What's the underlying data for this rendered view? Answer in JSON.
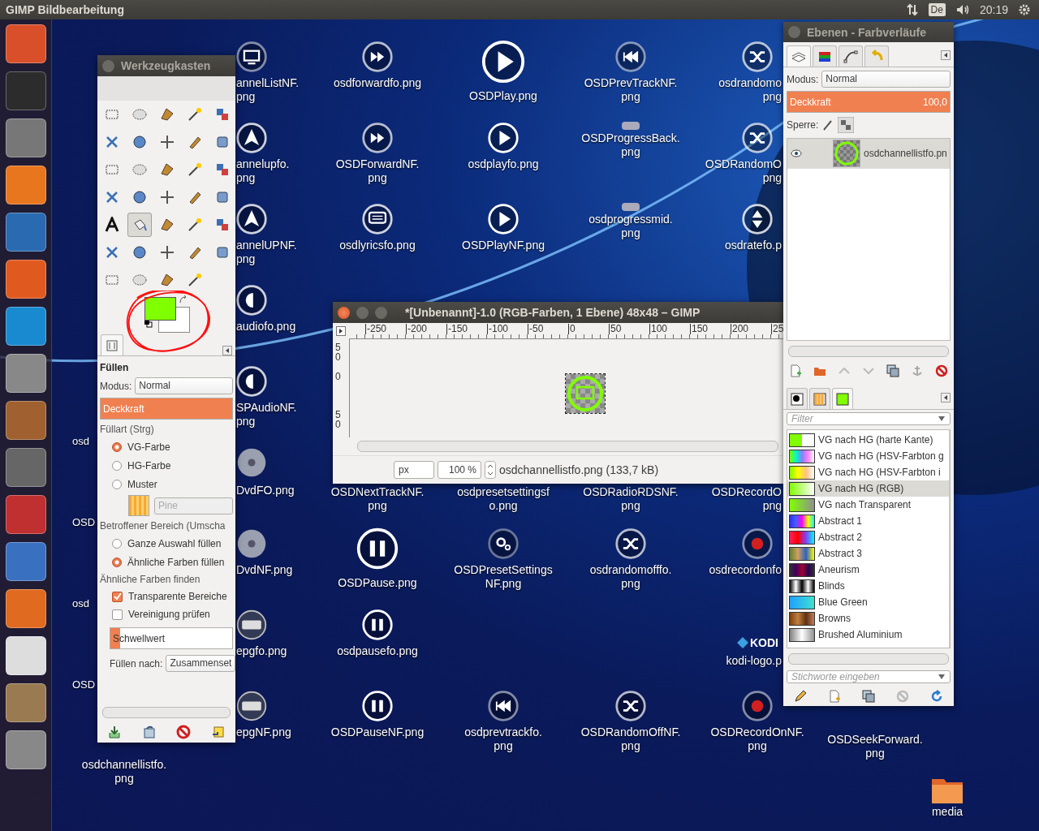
{
  "top_panel": {
    "title": "GIMP Bildbearbeitung",
    "keyboard_layout": "De",
    "time": "20:19"
  },
  "desktop_icons": [
    {
      "label": "annelListNF.\npng",
      "kind": "monitor"
    },
    {
      "label": "osdforwardfo.png",
      "kind": "forward"
    },
    {
      "label": "OSDPlay.png",
      "kind": "play"
    },
    {
      "label": "OSDPrevTrackNF.\npng",
      "kind": "rewind"
    },
    {
      "label": "osdrandomo\npng",
      "kind": "shuffle"
    },
    {
      "label": "annelupfo.\npng",
      "kind": "up"
    },
    {
      "label": "OSDForwardNF.\npng",
      "kind": "forward"
    },
    {
      "label": "osdplayfo.png",
      "kind": "play"
    },
    {
      "label": "OSDProgressBack.\npng",
      "kind": "bar"
    },
    {
      "label": "OSDRandomO\npng",
      "kind": "shuffle"
    },
    {
      "label": "annelUPNF.\npng",
      "kind": "up"
    },
    {
      "label": "osdlyricsfo.png",
      "kind": "chat"
    },
    {
      "label": "OSDPlayNF.png",
      "kind": "play"
    },
    {
      "label": "osdprogressmid.\npng",
      "kind": "bar"
    },
    {
      "label": "osdratefo.p",
      "kind": "updown"
    },
    {
      "label": "audiofo.png",
      "kind": "audio"
    },
    {
      "label": "SPAudioNF.\npng",
      "kind": "audio"
    },
    {
      "label": "osd",
      "kind": "none"
    },
    {
      "label": "DvdFO.png",
      "kind": "disc"
    },
    {
      "label": "OSDNextTrackNF.\npng",
      "kind": "none"
    },
    {
      "label": "osdpresetsettingsf\no.png",
      "kind": "none"
    },
    {
      "label": "OSDRadioRDSNF.\npng",
      "kind": "none"
    },
    {
      "label": "OSDRecordO\npng",
      "kind": "none"
    },
    {
      "label": "OSD",
      "kind": "none"
    },
    {
      "label": "DvdNF.png",
      "kind": "disc"
    },
    {
      "label": "OSDPause.png",
      "kind": "pause"
    },
    {
      "label": "OSDPresetSettings\nNF.png",
      "kind": "gear"
    },
    {
      "label": "osdrandomofffo.\npng",
      "kind": "shuffle"
    },
    {
      "label": "osdrecordonfo",
      "kind": "record"
    },
    {
      "label": "osd",
      "kind": "none"
    },
    {
      "label": "epgfo.png",
      "kind": "epg"
    },
    {
      "label": "osdpausefo.png",
      "kind": "pause"
    },
    {
      "label": "kodi-logo.p",
      "kind": "kodi",
      "logo_text": "KODI"
    },
    {
      "label": "OSD",
      "kind": "none"
    },
    {
      "label": "epgNF.png",
      "kind": "epg"
    },
    {
      "label": "OSDPauseNF.png",
      "kind": "pause"
    },
    {
      "label": "osdprevtrackfo.\npng",
      "kind": "rewind"
    },
    {
      "label": "OSDRandomOffNF.\npng",
      "kind": "shuffle"
    },
    {
      "label": "OSDRecordOnNF.\npng",
      "kind": "record"
    },
    {
      "label": "OSDSeekForward.\npng",
      "kind": "none"
    },
    {
      "label": "osdchannellistfo.\npng",
      "kind": "none"
    },
    {
      "label": "media",
      "kind": "folder"
    }
  ],
  "toolbox": {
    "title": "Werkzeugkasten",
    "tools": [
      {
        "selected": false
      },
      {
        "selected": false
      },
      {
        "selected": false
      },
      {
        "selected": false
      },
      {
        "selected": false
      },
      {
        "selected": false
      },
      {
        "selected": false
      },
      {
        "selected": false
      },
      {
        "selected": false
      },
      {
        "selected": false
      },
      {
        "selected": false
      },
      {
        "selected": false
      },
      {
        "selected": false
      },
      {
        "selected": false
      },
      {
        "selected": false
      },
      {
        "selected": false
      },
      {
        "selected": false
      },
      {
        "selected": false
      },
      {
        "selected": false
      },
      {
        "selected": false
      },
      {
        "selected": false
      },
      {
        "selected": true
      },
      {
        "selected": false
      },
      {
        "selected": false
      },
      {
        "selected": false
      },
      {
        "selected": false
      },
      {
        "selected": false
      },
      {
        "selected": false
      },
      {
        "selected": false
      },
      {
        "selected": false
      },
      {
        "selected": false
      },
      {
        "selected": false
      },
      {
        "selected": false
      },
      {
        "selected": false
      }
    ],
    "colors": [
      {
        "kind": "foreground",
        "color": "#80ff00"
      },
      {
        "kind": "background",
        "color": "#ffffff"
      }
    ],
    "options": {
      "title": "Füllen",
      "mode_label": "Modus:",
      "mode": "Normal",
      "opacity": {
        "label": "Deckkraft",
        "level": 1
      },
      "fill_type_label": "Füllart  (Strg)",
      "fill_types": [
        {
          "label": "VG-Farbe",
          "selected": true
        },
        {
          "label": "HG-Farbe",
          "selected": false
        },
        {
          "label": "Muster",
          "selected": false
        }
      ],
      "pattern": "Pine",
      "area_label": "Betroffener Bereich (Umscha",
      "areas": [
        {
          "label": "Ganze Auswahl füllen",
          "selected": false
        },
        {
          "label": "Ähnliche Farben füllen",
          "selected": true
        }
      ],
      "similar_label": "Ähnliche Farben finden",
      "checks": [
        {
          "label": "Transparente Bereiche",
          "checked": true
        },
        {
          "label": "Vereinigung prüfen",
          "checked": false
        }
      ],
      "threshold": {
        "label": "Schwellwert",
        "level": 0.08
      },
      "fill_by_label": "Füllen nach:",
      "fill_by": "Zusammenset"
    }
  },
  "image_window": {
    "title": "*[Unbenannt]-1.0 (RGB-Farben, 1 Ebene) 48x48 – GIMP",
    "ruler_labels": [
      "-250",
      "-200",
      "-150",
      "-100",
      "-50",
      "0",
      "50",
      "100",
      "150",
      "200",
      "25"
    ],
    "vertical_ruler_labels": [
      "50",
      "0",
      "50"
    ],
    "unit": "px",
    "zoom": "100 %",
    "status": "osdchannellistfo.png (133,7 kB)"
  },
  "dock": {
    "title": "Ebenen - Farbverläufe",
    "tabs": [
      {
        "selected": true
      },
      {
        "selected": false
      },
      {
        "selected": false
      },
      {
        "selected": false
      }
    ],
    "mode_label": "Modus:",
    "mode": "Normal",
    "opacity": {
      "label": "Deckkraft",
      "value": "100,0",
      "level": 1
    },
    "lock_label": "Sperre:",
    "layers": [
      {
        "name": "osdchannellistfo.pn",
        "visible": true,
        "selected": true
      }
    ],
    "tabs2": [
      {
        "selected": false
      },
      {
        "selected": false
      },
      {
        "selected": true
      }
    ],
    "filter_placeholder": "Filter",
    "gradients": [
      {
        "name": "VG nach HG (harte Kante)",
        "selected": false
      },
      {
        "name": "VG nach HG (HSV-Farbton g",
        "selected": false
      },
      {
        "name": "VG nach HG (HSV-Farbton i",
        "selected": false
      },
      {
        "name": "VG nach HG (RGB)",
        "selected": true
      },
      {
        "name": "VG nach Transparent",
        "selected": false
      },
      {
        "name": "Abstract 1",
        "selected": false
      },
      {
        "name": "Abstract 2",
        "selected": false
      },
      {
        "name": "Abstract 3",
        "selected": false
      },
      {
        "name": "Aneurism",
        "selected": false
      },
      {
        "name": "Blinds",
        "selected": false
      },
      {
        "name": "Blue Green",
        "selected": false
      },
      {
        "name": "Browns",
        "selected": false
      },
      {
        "name": "Brushed Aluminium",
        "selected": false
      }
    ],
    "tag_placeholder": "Stichworte eingeben"
  }
}
